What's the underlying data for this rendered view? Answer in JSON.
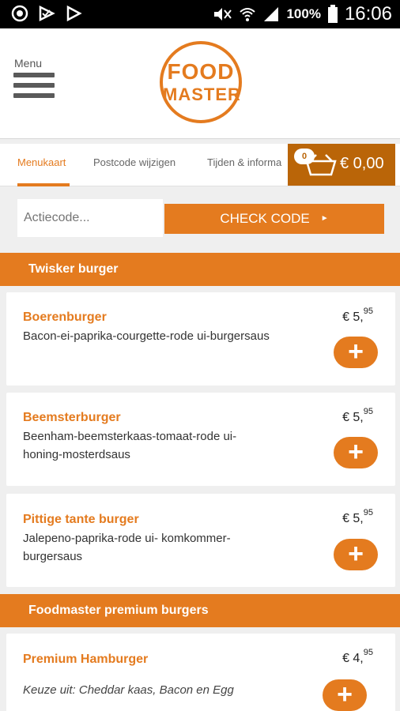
{
  "status_bar": {
    "battery_pct": "100%",
    "time": "16:06"
  },
  "header": {
    "menu_label": "Menu",
    "logo_line1": "FOOD",
    "logo_line2": "MASTER"
  },
  "tabs": [
    {
      "label": "Menukaart",
      "active": true
    },
    {
      "label": "Postcode wijzigen",
      "active": false
    },
    {
      "label": "Tijden & informa",
      "active": false
    }
  ],
  "cart": {
    "count": "0",
    "total": "€ 0,00"
  },
  "promo": {
    "placeholder": "Actiecode...",
    "button_label": "CHECK CODE"
  },
  "sections": [
    {
      "title": "Twisker burger",
      "items": [
        {
          "name": "Boerenburger",
          "desc": "Bacon-ei-paprika-courgette-rode ui-burgersaus",
          "price_main": "€ 5,",
          "price_cents": "95"
        },
        {
          "name": "Beemsterburger",
          "desc": "Beenham-beemsterkaas-tomaat-rode ui-honing-mosterdsaus",
          "price_main": "€ 5,",
          "price_cents": "95"
        },
        {
          "name": "Pittige tante burger",
          "desc": "Jalepeno-paprika-rode ui- komkommer-burgersaus",
          "price_main": "€ 5,",
          "price_cents": "95"
        }
      ]
    },
    {
      "title": "Foodmaster premium burgers",
      "items": [
        {
          "name": "Premium Hamburger",
          "desc": "Keuze uit: Cheddar kaas, Bacon en Egg",
          "price_main": "€ 4,",
          "price_cents": "95"
        }
      ]
    }
  ],
  "add_symbol": "+",
  "colors": {
    "accent": "#e47b1f",
    "cart_bg": "#ba6508",
    "status_bar_bg": "#000000"
  }
}
